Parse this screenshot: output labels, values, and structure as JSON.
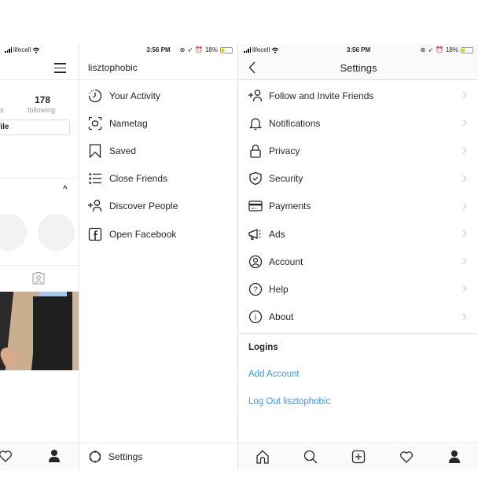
{
  "status_bar": {
    "carrier": "lifecell",
    "time": "3:56 PM",
    "battery": "18%",
    "battery_level": 0.18
  },
  "profile_partial": {
    "stat_label_partial": "s",
    "following_count": "178",
    "following_label": "following",
    "edit_profile_partial": "file",
    "caret_label": "^"
  },
  "menu": {
    "username": "lisztophobic",
    "items": [
      {
        "label": "Your Activity",
        "icon": "activity-clock-icon"
      },
      {
        "label": "Nametag",
        "icon": "nametag-icon"
      },
      {
        "label": "Saved",
        "icon": "bookmark-icon"
      },
      {
        "label": "Close Friends",
        "icon": "close-friends-list-icon"
      },
      {
        "label": "Discover People",
        "icon": "add-person-icon"
      },
      {
        "label": "Open Facebook",
        "icon": "facebook-icon"
      }
    ],
    "settings_label": "Settings"
  },
  "settings": {
    "title": "Settings",
    "items": [
      {
        "label": "Follow and Invite Friends",
        "icon": "add-person-icon"
      },
      {
        "label": "Notifications",
        "icon": "bell-icon"
      },
      {
        "label": "Privacy",
        "icon": "lock-icon"
      },
      {
        "label": "Security",
        "icon": "shield-check-icon"
      },
      {
        "label": "Payments",
        "icon": "credit-card-icon"
      },
      {
        "label": "Ads",
        "icon": "megaphone-icon"
      },
      {
        "label": "Account",
        "icon": "account-circle-icon"
      },
      {
        "label": "Help",
        "icon": "help-circle-icon"
      },
      {
        "label": "About",
        "icon": "info-circle-icon"
      }
    ],
    "logins_title": "Logins",
    "add_account": "Add Account",
    "log_out": "Log Out lisztophobic"
  },
  "colors": {
    "link": "#3897f0",
    "text": "#262626",
    "battery": "#f5c400"
  }
}
